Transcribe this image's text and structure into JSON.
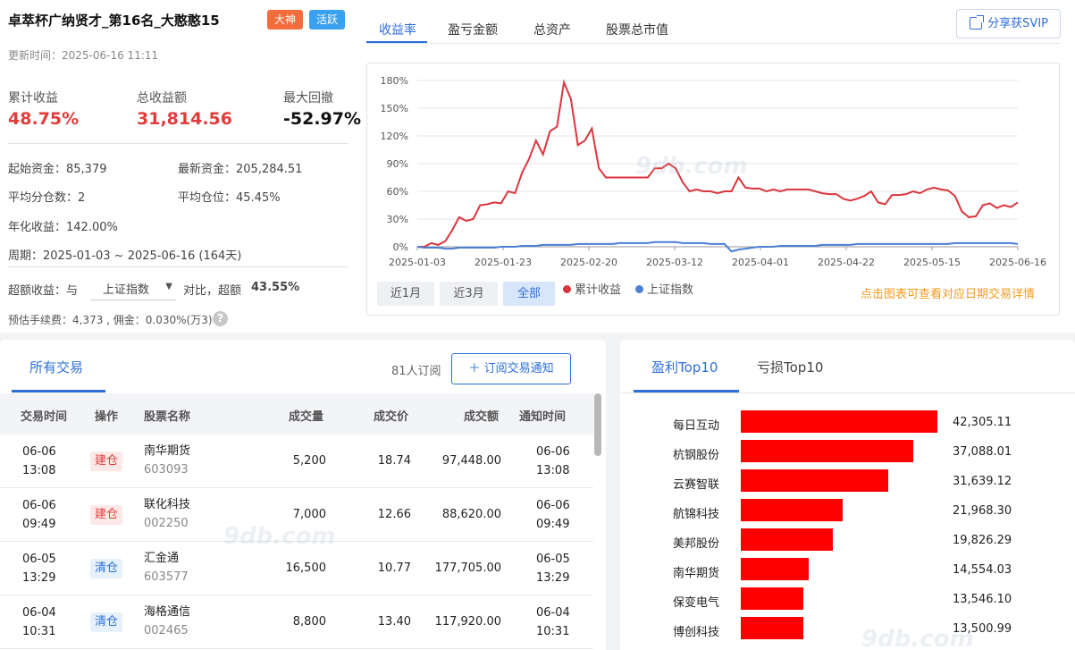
{
  "header": {
    "title": "卓萃杯广纳贤才_第16名_大憨憨15",
    "badges": [
      "大神",
      "活跃"
    ],
    "update_time": "更新时间：2025-06-16 11:11"
  },
  "kpis": [
    {
      "label": "累计收益",
      "value": "48.75%"
    },
    {
      "label": "总收益额",
      "value": "31,814.56"
    },
    {
      "label": "最大回撤",
      "value": "-52.97%"
    }
  ],
  "info": {
    "start_capital": "起始资金：85,379",
    "latest_capital": "最新资金：205,284.51",
    "avg_split": "平均分仓数：2",
    "avg_position": "平均仓位：45.45%",
    "annual_return": "年化收益：142.00%",
    "period": "周期：2025-01-03 ~ 2025-06-16 (164天)",
    "excess_prefix": "超额收益：与",
    "excess_select": "上证指数",
    "excess_mid": "对比，超额",
    "excess_value": "43.55%",
    "fees": "预估手续费：4,373 , 佣金：0.030%(万3)",
    "help_icon": "?"
  },
  "chart_tabs": [
    "收益率",
    "盈亏金额",
    "总资产",
    "股票总市值"
  ],
  "share_button": "分享获SVIP",
  "range_buttons": [
    "近1月",
    "近3月",
    "全部"
  ],
  "legend": [
    {
      "name": "累计收益",
      "color": "#d9363e"
    },
    {
      "name": "上证指数",
      "color": "#4a7fd4"
    }
  ],
  "chart_hint": "点击图表可查看对应日期交易详情",
  "watermark": "9db.com",
  "chart_data": {
    "type": "line",
    "y_ticks": [
      "180%",
      "150%",
      "120%",
      "90%",
      "60%",
      "30%",
      "0%"
    ],
    "x_ticks": [
      "2025-01-03",
      "2025-01-23",
      "2025-02-20",
      "2025-03-12",
      "2025-04-01",
      "2025-04-22",
      "2025-05-15",
      "2025-06-16"
    ],
    "ylim": [
      0,
      180
    ],
    "series": [
      {
        "name": "累计收益",
        "color": "#d9363e",
        "values": [
          0,
          0,
          4,
          2,
          6,
          18,
          32,
          28,
          30,
          45,
          46,
          48,
          47,
          60,
          58,
          80,
          95,
          115,
          100,
          125,
          130,
          178,
          160,
          110,
          115,
          128,
          85,
          75,
          75,
          75,
          75,
          75,
          75,
          75,
          85,
          85,
          90,
          85,
          70,
          60,
          62,
          60,
          60,
          58,
          60,
          60,
          75,
          64,
          63,
          63,
          60,
          62,
          60,
          62,
          62,
          62,
          62,
          60,
          58,
          57,
          57,
          52,
          50,
          52,
          55,
          60,
          48,
          46,
          56,
          56,
          57,
          60,
          58,
          62,
          64,
          62,
          61,
          55,
          38,
          32,
          33,
          45,
          47,
          42,
          45,
          43,
          48
        ]
      },
      {
        "name": "上证指数",
        "color": "#4a7fd4",
        "values": [
          0,
          -1,
          -1,
          -1,
          -2,
          -2,
          -1,
          -1,
          -1,
          -1,
          -1,
          -1,
          0,
          0,
          0,
          1,
          1,
          1,
          2,
          2,
          2,
          2,
          2,
          3,
          3,
          3,
          3,
          3,
          3,
          4,
          4,
          4,
          4,
          4,
          5,
          5,
          5,
          5,
          4,
          4,
          4,
          4,
          3,
          3,
          3,
          -5,
          -3,
          -2,
          -1,
          0,
          0,
          0,
          1,
          1,
          1,
          1,
          1,
          1,
          2,
          2,
          2,
          2,
          2,
          3,
          3,
          3,
          3,
          3,
          3,
          3,
          3,
          3,
          3,
          3,
          3,
          3,
          3,
          4,
          4,
          4,
          4,
          4,
          4,
          4,
          4,
          4,
          3
        ]
      }
    ]
  },
  "trades": {
    "tab": "所有交易",
    "subscribers": "81人订阅",
    "subscribe_button": "订阅交易通知",
    "columns": [
      "交易时间",
      "操作",
      "股票名称",
      "成交量",
      "成交价",
      "成交额",
      "通知时间"
    ],
    "rows": [
      {
        "date": "06-06",
        "time": "13:08",
        "op": "建仓",
        "op_type": "open",
        "name": "南华期货",
        "code": "603093",
        "qty": "5,200",
        "price": "18.74",
        "amount": "97,448.00",
        "n_date": "06-06",
        "n_time": "13:08"
      },
      {
        "date": "06-06",
        "time": "09:49",
        "op": "建仓",
        "op_type": "open",
        "name": "联化科技",
        "code": "002250",
        "qty": "7,000",
        "price": "12.66",
        "amount": "88,620.00",
        "n_date": "06-06",
        "n_time": "09:49"
      },
      {
        "date": "06-05",
        "time": "13:29",
        "op": "清仓",
        "op_type": "close",
        "name": "汇金通",
        "code": "603577",
        "qty": "16,500",
        "price": "10.77",
        "amount": "177,705.00",
        "n_date": "06-05",
        "n_time": "13:29"
      },
      {
        "date": "06-04",
        "time": "10:31",
        "op": "清仓",
        "op_type": "close",
        "name": "海格通信",
        "code": "002465",
        "qty": "8,800",
        "price": "13.40",
        "amount": "117,920.00",
        "n_date": "06-04",
        "n_time": "10:31"
      }
    ]
  },
  "top10": {
    "tabs": [
      "盈利Top10",
      "亏损Top10"
    ],
    "bar_color": "#ff0000",
    "items": [
      {
        "name": "每日互动",
        "value": 42305.11,
        "label": "42,305.11"
      },
      {
        "name": "杭钢股份",
        "value": 37088.01,
        "label": "37,088.01"
      },
      {
        "name": "云赛智联",
        "value": 31639.12,
        "label": "31,639.12"
      },
      {
        "name": "航锦科技",
        "value": 21968.3,
        "label": "21,968.30"
      },
      {
        "name": "美邦股份",
        "value": 19826.29,
        "label": "19,826.29"
      },
      {
        "name": "南华期货",
        "value": 14554.03,
        "label": "14,554.03"
      },
      {
        "name": "保变电气",
        "value": 13546.1,
        "label": "13,546.10"
      },
      {
        "name": "博创科技",
        "value": 13500.99,
        "label": "13,500.99"
      }
    ]
  }
}
